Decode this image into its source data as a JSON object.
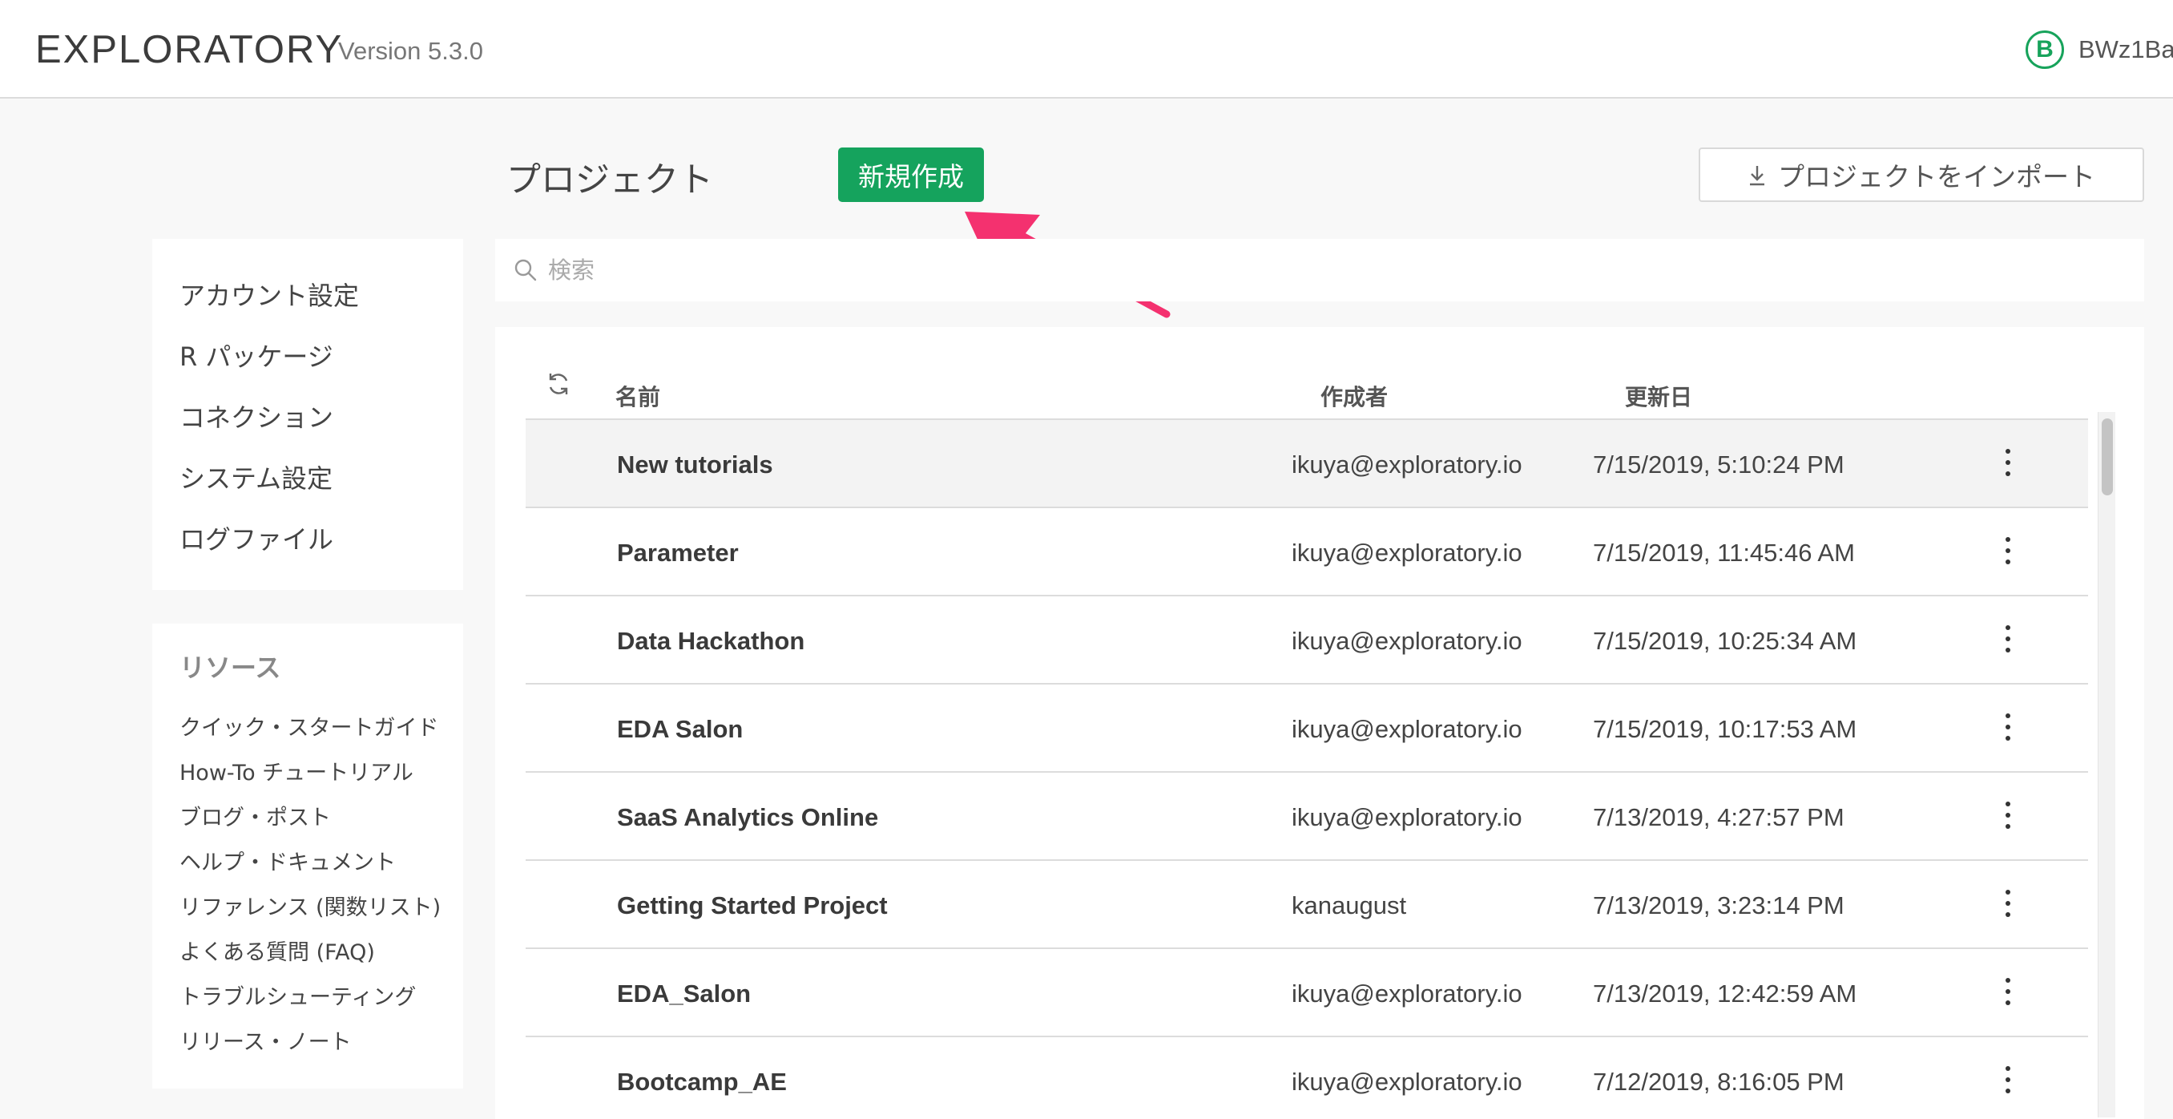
{
  "header": {
    "brand": "EXPLORATORY",
    "version": "Version 5.3.0",
    "user_initial": "B",
    "user_name": "BWz1Ba"
  },
  "main": {
    "title": "プロジェクト",
    "new_button": "新規作成",
    "import_button": "プロジェクトをインポート"
  },
  "search": {
    "placeholder": "検索",
    "value": ""
  },
  "sidebar": {
    "settings": [
      "アカウント設定",
      "R パッケージ",
      "コネクション",
      "システム設定",
      "ログファイル"
    ],
    "resources_title": "リソース",
    "resources": [
      "クイック・スタートガイド",
      "How-To チュートリアル",
      "ブログ・ポスト",
      "ヘルプ・ドキュメント",
      "リファレンス (関数リスト)",
      "よくある質問 (FAQ)",
      "トラブルシューティング",
      "リリース・ノート"
    ]
  },
  "table": {
    "columns": {
      "name": "名前",
      "author": "作成者",
      "updated": "更新日"
    },
    "rows": [
      {
        "name": "New tutorials",
        "author": "ikuya@exploratory.io",
        "updated": "7/15/2019, 5:10:24 PM"
      },
      {
        "name": "Parameter",
        "author": "ikuya@exploratory.io",
        "updated": "7/15/2019, 11:45:46 AM"
      },
      {
        "name": "Data Hackathon",
        "author": "ikuya@exploratory.io",
        "updated": "7/15/2019, 10:25:34 AM"
      },
      {
        "name": "EDA Salon",
        "author": "ikuya@exploratory.io",
        "updated": "7/15/2019, 10:17:53 AM"
      },
      {
        "name": "SaaS Analytics Online",
        "author": "ikuya@exploratory.io",
        "updated": "7/13/2019, 4:27:57 PM"
      },
      {
        "name": "Getting Started Project",
        "author": "kanaugust",
        "updated": "7/13/2019, 3:23:14 PM"
      },
      {
        "name": "EDA_Salon",
        "author": "ikuya@exploratory.io",
        "updated": "7/13/2019, 12:42:59 AM"
      },
      {
        "name": "Bootcamp_AE",
        "author": "ikuya@exploratory.io",
        "updated": "7/12/2019, 8:16:05 PM"
      }
    ]
  },
  "colors": {
    "accent": "#15a35d",
    "annotation_arrow": "#f4316f"
  },
  "icons": [
    "user-badge-icon",
    "download-icon",
    "search-icon",
    "refresh-icon",
    "kebab-menu-icon"
  ]
}
